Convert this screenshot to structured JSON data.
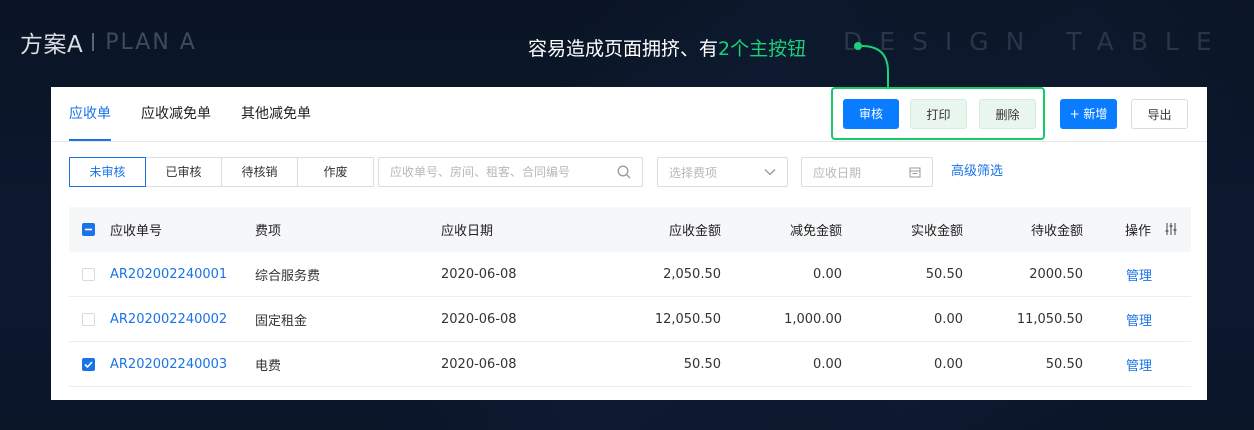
{
  "header": {
    "plan_cn": "方案A",
    "plan_en": "PLAN A",
    "watermark": "DESIGN TABLE",
    "annotation_prefix": "容易造成页面拥挤、有",
    "annotation_highlight": "2个主按钮"
  },
  "tabs": [
    {
      "label": "应收单",
      "active": true
    },
    {
      "label": "应收减免单",
      "active": false
    },
    {
      "label": "其他减免单",
      "active": false
    }
  ],
  "actions": {
    "approve": "审核",
    "print": "打印",
    "delete": "删除",
    "add": "+ 新增",
    "export": "导出"
  },
  "status_filters": [
    {
      "label": "未审核",
      "active": true
    },
    {
      "label": "已审核",
      "active": false
    },
    {
      "label": "待核销",
      "active": false
    },
    {
      "label": "作废",
      "active": false
    }
  ],
  "search": {
    "placeholder": "应收单号、房间、租客、合同编号",
    "fee_placeholder": "选择费项",
    "date_placeholder": "应收日期",
    "advanced": "高级筛选"
  },
  "table": {
    "columns": [
      "应收单号",
      "费项",
      "应收日期",
      "应收金额",
      "减免金额",
      "实收金额",
      "待收金额",
      "操作"
    ],
    "rows": [
      {
        "checked": false,
        "no": "AR202002240001",
        "fee": "综合服务费",
        "date": "2020-06-08",
        "receivable": "2,050.50",
        "waived": "0.00",
        "received": "50.50",
        "pending": "2000.50",
        "action": "管理"
      },
      {
        "checked": false,
        "no": "AR202002240002",
        "fee": "固定租金",
        "date": "2020-06-08",
        "receivable": "12,050.50",
        "waived": "1,000.00",
        "received": "0.00",
        "pending": "11,050.50",
        "action": "管理"
      },
      {
        "checked": true,
        "no": "AR202002240003",
        "fee": "电费",
        "date": "2020-06-08",
        "receivable": "50.50",
        "waived": "0.00",
        "received": "0.00",
        "pending": "50.50",
        "action": "管理"
      }
    ]
  },
  "colors": {
    "primary": "#0a7cff",
    "link": "#1a73e8",
    "highlight": "#19d07b",
    "background": "#0b1628"
  },
  "icons": [
    "search-icon",
    "chevron-down-icon",
    "calendar-icon",
    "settings-sliders-icon",
    "checkbox-partial-icon",
    "checkbox-checked-icon"
  ]
}
